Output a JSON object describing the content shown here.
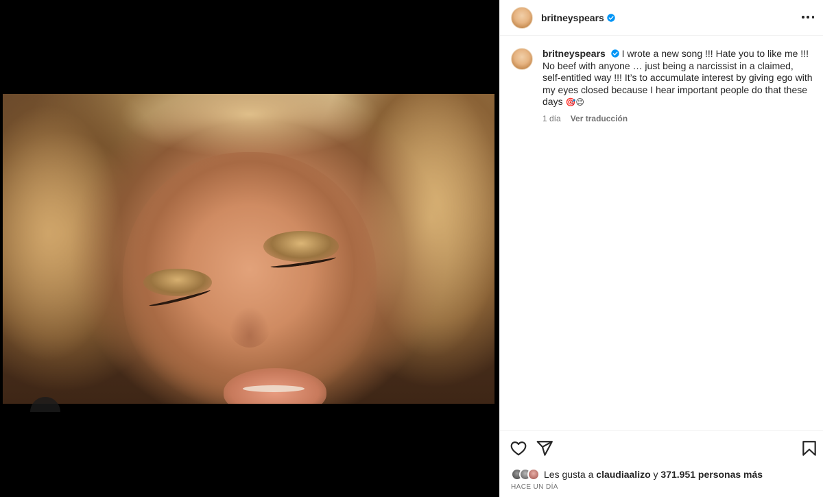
{
  "post": {
    "username": "britneyspears",
    "caption_text": "I wrote a new song !!! Hate you to like me !!! No beef with anyone … just being a narcissist in a claimed, self-entitled way !!! It’s to accumulate interest by giving ego with my eyes closed because I hear important people do that these days",
    "caption_emoji": "🎯😉",
    "age": "1 día",
    "translate_label": "Ver traducción"
  },
  "likes": {
    "prefix": "Les gusta a",
    "first_user": "claudiaalizo",
    "connector": "y",
    "others": "371.951 personas más"
  },
  "timestamp": "HACE UN DÍA",
  "icons": {
    "more": "more-options-icon",
    "verified": "verified-badge-icon",
    "like": "heart-icon",
    "share": "paper-plane-icon",
    "save": "bookmark-icon"
  },
  "colors": {
    "verified": "#0095f6",
    "text": "#262626",
    "secondary": "#737373"
  }
}
